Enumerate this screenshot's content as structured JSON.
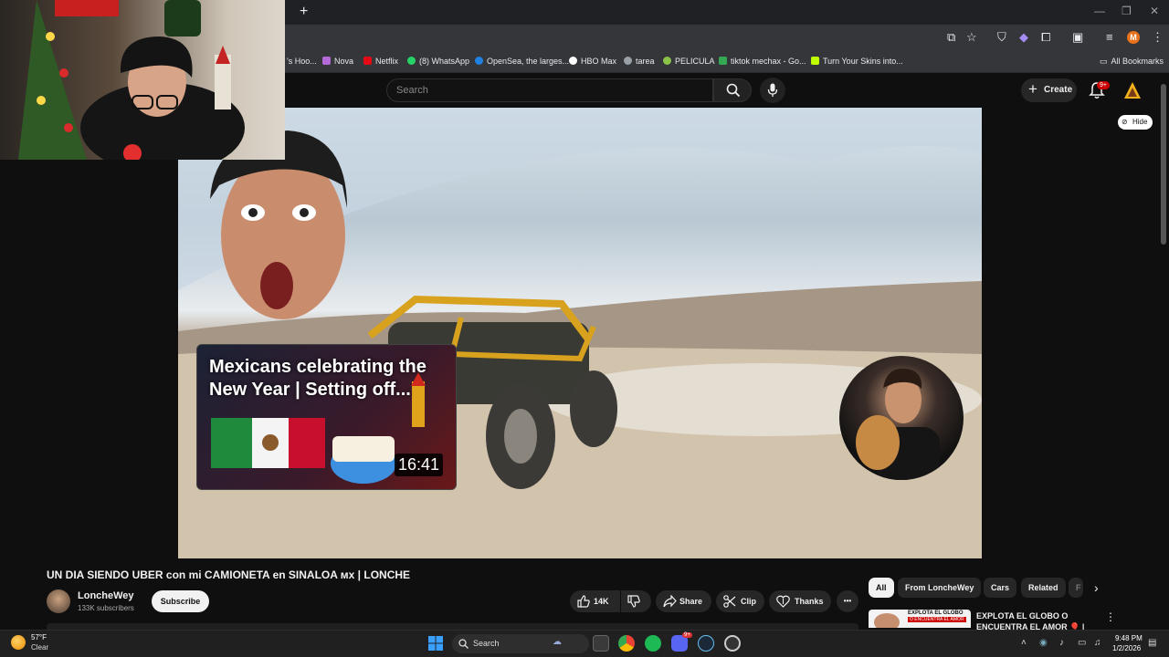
{
  "browser": {
    "new_tab": "+",
    "window_controls": [
      "—",
      "❐",
      "✕"
    ],
    "profile_initial": "M",
    "bookmarks": [
      {
        "label": "'s Hoo...",
        "color": "#888888"
      },
      {
        "label": "Nova",
        "color": "#b36ad8"
      },
      {
        "label": "Netflix",
        "color": "#e50914"
      },
      {
        "label": "(8) WhatsApp",
        "color": "#25d366"
      },
      {
        "label": "OpenSea, the larges...",
        "color": "#2081e2"
      },
      {
        "label": "HBO Max",
        "color": "#ffffff"
      },
      {
        "label": "tarea",
        "color": "#9aa0a6"
      },
      {
        "label": "PELICULA",
        "color": "#8bc34a"
      },
      {
        "label": "tiktok mechax - Go...",
        "color": "#34a853"
      },
      {
        "label": "Turn Your Skins into...",
        "color": "#c0ff00"
      }
    ],
    "all_bookmarks": "All Bookmarks"
  },
  "youtube": {
    "search_placeholder": "Search",
    "create_label": "Create",
    "notification_badge": "9+",
    "hide_label": "Hide"
  },
  "endcard": {
    "title": "Mexicans celebrating the New Year | Setting off...",
    "duration": "16:41"
  },
  "video": {
    "title": "UN DIA SIENDO UBER con mi CAMIONETA en SINALOA ᴍx | LONCHE",
    "channel": "LoncheWey",
    "subscribers": "133K subscribers",
    "subscribe_label": "Subscribe",
    "likes": "14K",
    "share_label": "Share",
    "clip_label": "Clip",
    "thanks_label": "Thanks",
    "more": "•••"
  },
  "chips": [
    "All",
    "From LoncheWey",
    "Cars",
    "Related",
    "F"
  ],
  "recommendation": {
    "title": "EXPLOTA EL GLOBO O ENCUENTRA EL AMOR 🎈 |",
    "thumb_text": "EXPLOTA EL GLOBO",
    "thumb_sub": "O ENCUENTRA EL AMOR",
    "menu": "⋮"
  },
  "taskbar": {
    "temperature": "57°F",
    "condition": "Clear",
    "search_label": "Search",
    "time": "9:48 PM",
    "date": "1/2/2026",
    "discord_badge": "9+"
  }
}
